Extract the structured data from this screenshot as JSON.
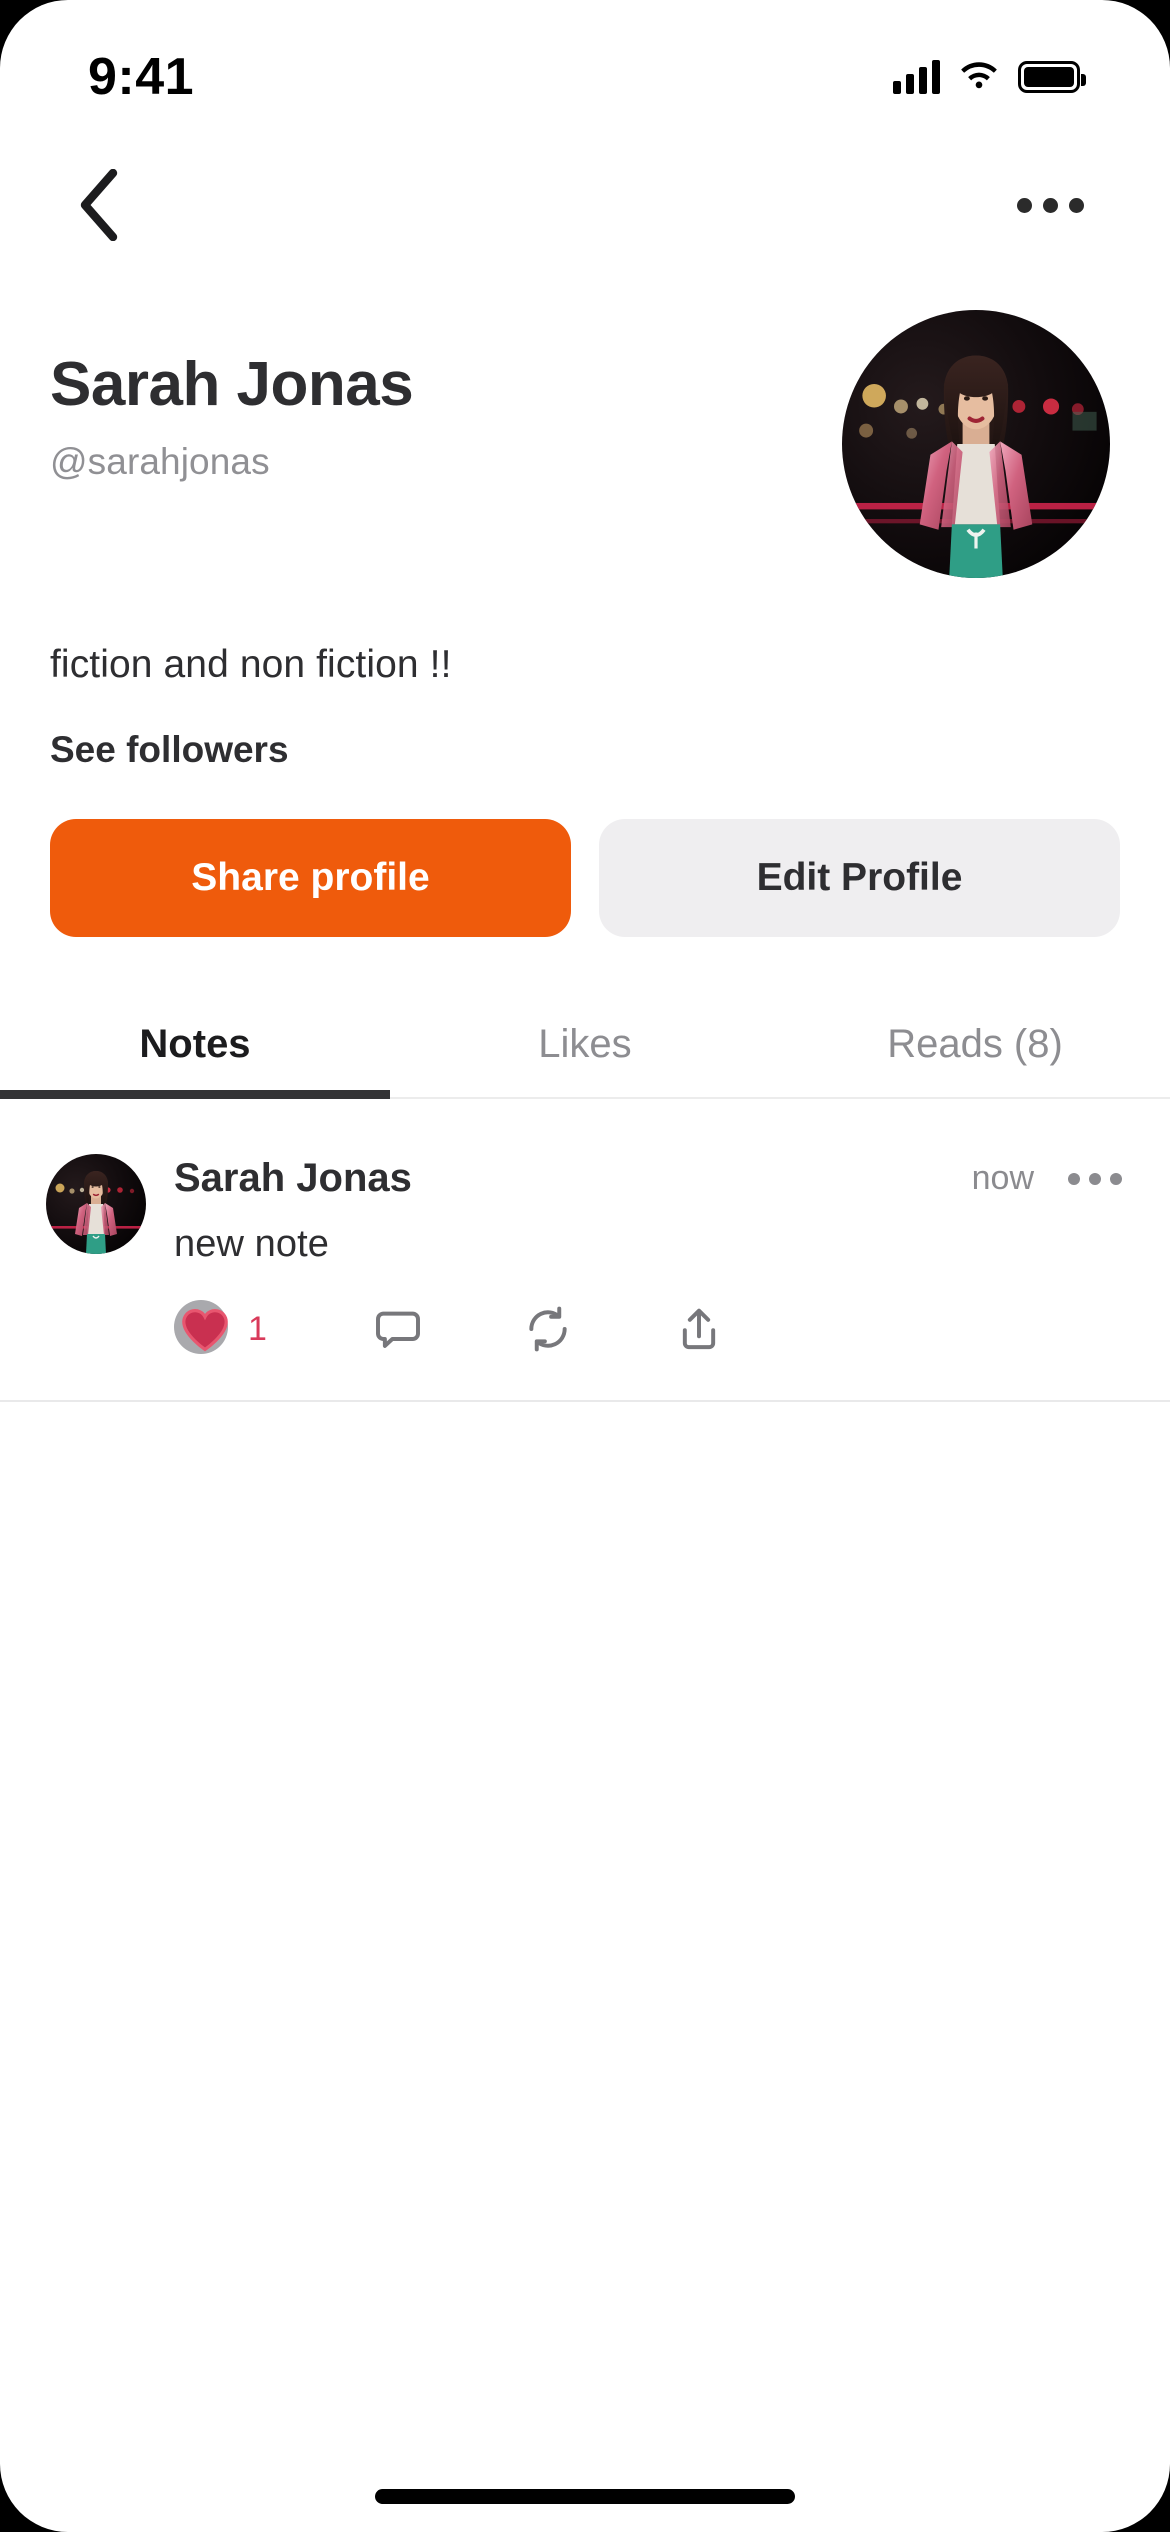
{
  "status_bar": {
    "time": "9:41",
    "signal_icon": "cellular-bars-icon",
    "wifi_icon": "wifi-icon",
    "battery_icon": "battery-full-icon"
  },
  "navbar": {
    "back_icon": "chevron-left-icon",
    "more_icon": "ellipsis-horizontal-icon"
  },
  "profile": {
    "name": "Sarah Jonas",
    "handle": "@sarahjonas",
    "bio": "fiction and non fiction !!",
    "followers_link": "See followers",
    "avatar_icon": "profile-avatar",
    "avatar_alt": "Woman in pink satin jacket at night with bokeh city lights"
  },
  "actions": {
    "share_label": "Share profile",
    "edit_label": "Edit Profile",
    "share_color": "#ef5b0c",
    "edit_color": "#efeef0"
  },
  "tabs": [
    {
      "label": "Notes",
      "active": true
    },
    {
      "label": "Likes",
      "active": false
    },
    {
      "label": "Reads (8)",
      "active": false
    }
  ],
  "note": {
    "author": "Sarah Jonas",
    "timestamp": "now",
    "text": "new note",
    "avatar_icon": "note-author-avatar",
    "more_icon": "ellipsis-horizontal-icon",
    "like_count": "1",
    "like_icon": "heart-filled-icon",
    "like_color": "#d93a5a",
    "comment_icon": "comment-bubble-icon",
    "repost_icon": "repost-arrows-icon",
    "share_icon": "share-upload-icon"
  },
  "colors": {
    "accent_orange": "#ef5b0c",
    "text_primary": "#2e2e31",
    "text_muted": "#8b8b8f",
    "tab_underline": "#333335"
  }
}
